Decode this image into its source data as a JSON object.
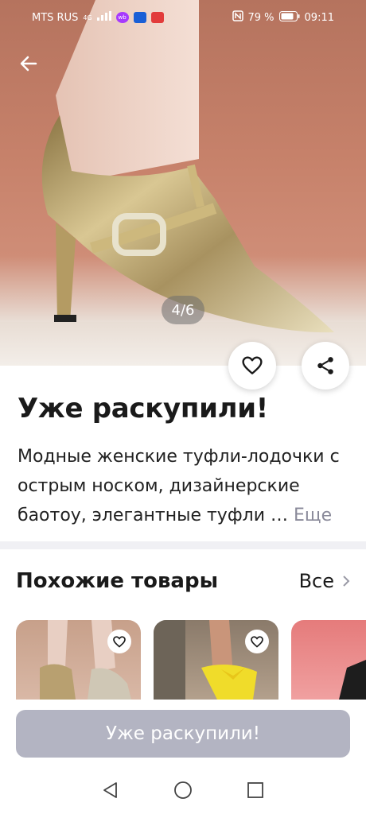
{
  "status_bar": {
    "carrier": "MTS RUS",
    "network": "4G",
    "battery": "79 %",
    "time": "09:11",
    "badges": [
      {
        "label": "wb",
        "color": "#a73afd"
      },
      {
        "label": "",
        "color": "#1a5fd6"
      },
      {
        "label": "",
        "color": "#e23b3b"
      }
    ]
  },
  "gallery": {
    "counter": "4/6"
  },
  "product": {
    "title": "Уже раскупили!",
    "description": "Модные женские туфли-лодочки с острым носком, дизайнерские баотоу, элегантные туфли …",
    "more_label": "Еще"
  },
  "similar": {
    "title": "Похожие товары",
    "all_label": "Все"
  },
  "buy_button": {
    "label": "Уже раскупили!",
    "color": "#b3b4c2"
  },
  "icons": {
    "back": "arrow-left-icon",
    "favorite": "heart-icon",
    "share": "share-icon",
    "chevron": "chevron-right-icon",
    "nav_back": "triangle-back-icon",
    "nav_home": "circle-home-icon",
    "nav_recent": "square-recent-icon"
  },
  "colors": {
    "accent_more": "#8a8a9a",
    "divider": "#f0f0f4"
  }
}
